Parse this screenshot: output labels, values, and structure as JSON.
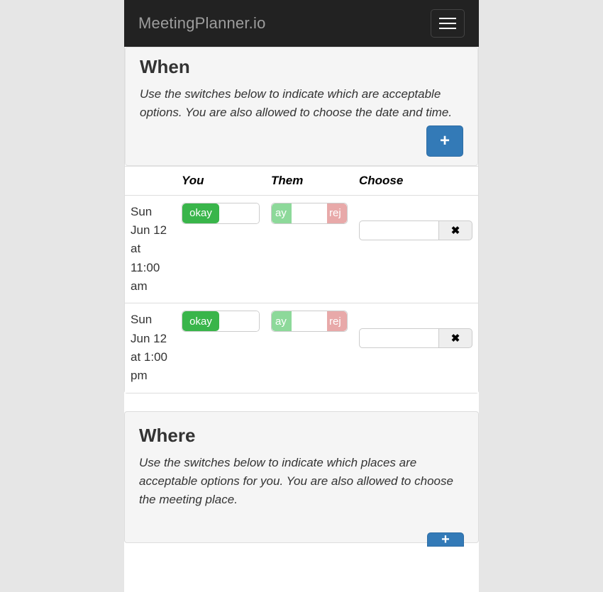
{
  "nav": {
    "brand": "MeetingPlanner.io"
  },
  "when": {
    "heading": "When",
    "desc": "Use the switches below to indicate which are acceptable options.  You are also allowed to choose the date and time.",
    "add_label": "+",
    "columns": {
      "c0": "",
      "c1": "You",
      "c2": "Them",
      "c3": "Choose"
    },
    "rows": [
      {
        "datetime": "Sun Jun 12 at 11:00 am",
        "you_ok": "okay",
        "them_ok": "ay",
        "them_rej": "rej",
        "remove": "✖"
      },
      {
        "datetime": "Sun Jun 12 at 1:00 pm",
        "you_ok": "okay",
        "them_ok": "ay",
        "them_rej": "rej",
        "remove": "✖"
      }
    ]
  },
  "where": {
    "heading": "Where",
    "desc": "Use the switches below to indicate which places are acceptable options for you.  You are also allowed to choose the meeting place.",
    "add_label": "+"
  }
}
